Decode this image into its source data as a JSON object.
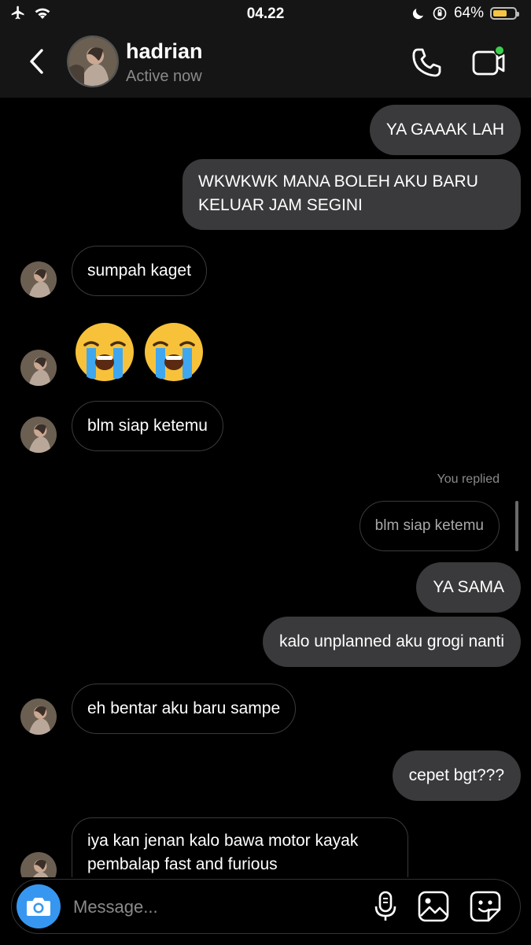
{
  "status_bar": {
    "time": "04.22",
    "battery_percent_label": "64%",
    "battery_level": 0.64,
    "icons": [
      "airplane-icon",
      "wifi-icon",
      "moon-icon",
      "orientation-lock-icon",
      "battery-icon"
    ]
  },
  "header": {
    "name": "hadrian",
    "status": "Active now",
    "icons": [
      "back-chevron-icon",
      "phone-icon",
      "video-camera-icon"
    ],
    "active_dot_color": "#3ccf4e"
  },
  "messages": [
    {
      "dir": "out",
      "text": "YA GAAAK LAH"
    },
    {
      "dir": "out",
      "text": "WKWKWK MANA BOLEH AKU BARU KELUAR JAM SEGINI"
    },
    {
      "dir": "in",
      "text": "sumpah kaget"
    },
    {
      "dir": "in",
      "type": "emoji",
      "text": "😭😭"
    },
    {
      "dir": "in",
      "text": "blm siap ketemu"
    },
    {
      "dir": "out",
      "type": "reply",
      "reply_label": "You replied",
      "quote": "blm siap ketemu",
      "text": "YA SAMA"
    },
    {
      "dir": "out",
      "text": "kalo unplanned aku grogi nanti"
    },
    {
      "dir": "in",
      "text": "eh bentar aku baru sampe"
    },
    {
      "dir": "out",
      "text": "cepet bgt???"
    },
    {
      "dir": "in",
      "text": "iya kan jenan kalo bawa motor kayak pembalap fast and furious"
    }
  ],
  "composer": {
    "placeholder": "Message...",
    "icons": [
      "camera-icon",
      "microphone-icon",
      "gallery-icon",
      "sticker-icon"
    ],
    "camera_color": "#3797f0"
  },
  "colors": {
    "outgoing_bubble": "#3a3a3c",
    "incoming_border": "#3a3a3a",
    "background": "#000000"
  }
}
